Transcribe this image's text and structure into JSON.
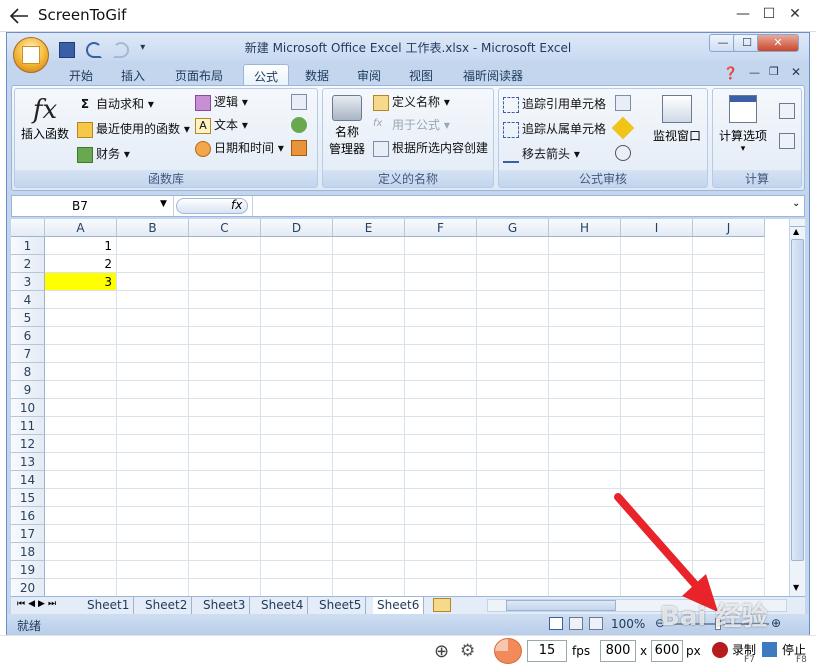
{
  "screentogif": {
    "title": "ScreenToGif",
    "minimize_label": "—",
    "maximize_label": "☐",
    "close_label": "✕",
    "fps_value": "15",
    "fps_unit": "fps",
    "width_value": "800",
    "times": "x",
    "height_value": "600",
    "px_unit": "px",
    "record_label": "录制",
    "record_key": "F7",
    "stop_label": "停止",
    "stop_key": "F8"
  },
  "excel": {
    "window_title": "新建 Microsoft Office Excel 工作表.xlsx - Microsoft Excel",
    "tabs": [
      "开始",
      "插入",
      "页面布局",
      "公式",
      "数据",
      "审阅",
      "视图",
      "福昕阅读器"
    ],
    "active_tab": "公式",
    "groups": {
      "function_library": {
        "label": "函数库",
        "insert_function": "插入函数",
        "autosum": "自动求和",
        "recent": "最近使用的函数",
        "financial": "财务",
        "logical": "逻辑",
        "text": "文本",
        "datetime": "日期和时间"
      },
      "defined_names": {
        "label": "定义的名称",
        "name_manager_1": "名称",
        "name_manager_2": "管理器",
        "define_name": "定义名称",
        "use_in_formula": "用于公式",
        "create_from_selection": "根据所选内容创建"
      },
      "formula_auditing": {
        "label": "公式审核",
        "trace_precedents": "追踪引用单元格",
        "trace_dependents": "追踪从属单元格",
        "remove_arrows": "移去箭头",
        "watch_window": "监视窗口"
      },
      "calculation": {
        "label": "计算",
        "options": "计算选项"
      }
    },
    "name_box": "B7",
    "fx_symbol": "fx",
    "columns": [
      "A",
      "B",
      "C",
      "D",
      "E",
      "F",
      "G",
      "H",
      "I",
      "J"
    ],
    "rows": [
      "1",
      "2",
      "3",
      "4",
      "5",
      "6",
      "7",
      "8",
      "9",
      "10",
      "11",
      "12",
      "13",
      "14",
      "15",
      "16",
      "17",
      "18",
      "19",
      "20"
    ],
    "cells": {
      "A1": "1",
      "A2": "2",
      "A3": "3"
    },
    "highlight_color": "#ffff00",
    "sheets": [
      "Sheet1",
      "Sheet2",
      "Sheet3",
      "Sheet4",
      "Sheet5",
      "Sheet6"
    ],
    "active_sheet": "Sheet6",
    "status_text": "就绪",
    "zoom": "100%"
  },
  "overlay": {
    "arrow_color": "#e8232a",
    "watermark": "Bai 经验"
  }
}
